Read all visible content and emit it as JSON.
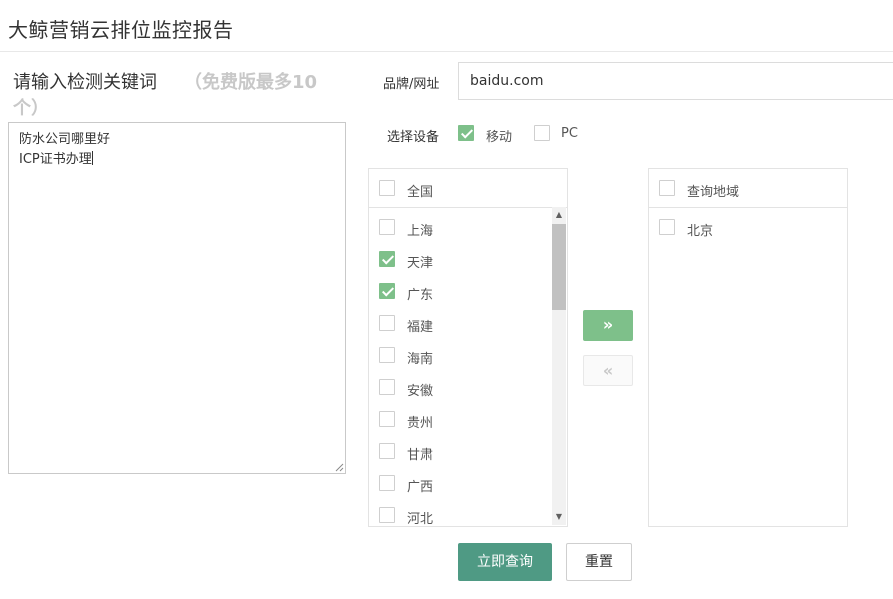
{
  "header": {
    "title": "大鲸营销云排位监控报告"
  },
  "keywords": {
    "label": "请输入检测关键词",
    "hint_line1": "（免费版最多10",
    "hint_line2": "个）",
    "lines": [
      "防水公司哪里好",
      "ICP证书办理"
    ]
  },
  "brand": {
    "label": "品牌/网址",
    "value": "baidu.com"
  },
  "device": {
    "label": "选择设备",
    "options": [
      {
        "label": "移动",
        "checked": true
      },
      {
        "label": "PC",
        "checked": false
      }
    ]
  },
  "source_regions": {
    "header_label": "全国",
    "items": [
      {
        "label": "上海",
        "checked": false
      },
      {
        "label": "天津",
        "checked": true
      },
      {
        "label": "广东",
        "checked": true
      },
      {
        "label": "福建",
        "checked": false
      },
      {
        "label": "海南",
        "checked": false
      },
      {
        "label": "安徽",
        "checked": false
      },
      {
        "label": "贵州",
        "checked": false
      },
      {
        "label": "甘肃",
        "checked": false
      },
      {
        "label": "广西",
        "checked": false
      },
      {
        "label": "河北",
        "checked": false
      }
    ]
  },
  "target_regions": {
    "header_label": "查询地域",
    "items": [
      {
        "label": "北京",
        "checked": false
      }
    ]
  },
  "transfer": {
    "right_symbol": "»",
    "left_symbol": "«"
  },
  "actions": {
    "query_label": "立即查询",
    "reset_label": "重置"
  },
  "colors": {
    "accent_green": "#7ec08a",
    "primary_button": "#4f9a84"
  }
}
